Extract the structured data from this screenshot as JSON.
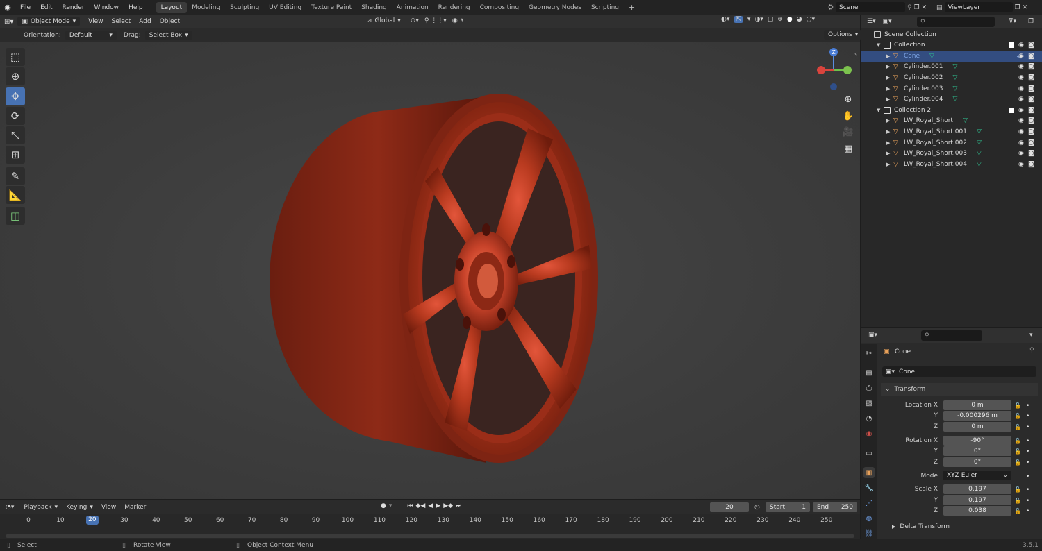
{
  "topbar": {
    "menus": [
      "File",
      "Edit",
      "Render",
      "Window",
      "Help"
    ],
    "workspaces": [
      "Layout",
      "Modeling",
      "Sculpting",
      "UV Editing",
      "Texture Paint",
      "Shading",
      "Animation",
      "Rendering",
      "Compositing",
      "Geometry Nodes",
      "Scripting"
    ],
    "active_workspace": "Layout",
    "add_tab": "+",
    "scene": "Scene",
    "view_layer": "ViewLayer"
  },
  "viewport_header": {
    "mode": "Object Mode",
    "menus": [
      "View",
      "Select",
      "Add",
      "Object"
    ],
    "transform_orientation": "Global",
    "orientation_label": "Orientation:",
    "orientation_value": "Default",
    "drag_label": "Drag:",
    "drag_value": "Select Box",
    "options": "Options"
  },
  "gizmo": {
    "z": "Z"
  },
  "outliner": {
    "root": "Scene Collection",
    "rows": [
      {
        "name": "Collection",
        "type": "collection",
        "indent": 1
      },
      {
        "name": "Cone",
        "type": "mesh",
        "indent": 2,
        "selected": true
      },
      {
        "name": "Cylinder.001",
        "type": "mesh",
        "indent": 2
      },
      {
        "name": "Cylinder.002",
        "type": "mesh",
        "indent": 2
      },
      {
        "name": "Cylinder.003",
        "type": "mesh",
        "indent": 2
      },
      {
        "name": "Cylinder.004",
        "type": "mesh",
        "indent": 2
      },
      {
        "name": "Collection 2",
        "type": "collection",
        "indent": 1
      },
      {
        "name": "LW_Royal_Short",
        "type": "mesh",
        "indent": 2
      },
      {
        "name": "LW_Royal_Short.001",
        "type": "mesh",
        "indent": 2
      },
      {
        "name": "LW_Royal_Short.002",
        "type": "mesh",
        "indent": 2
      },
      {
        "name": "LW_Royal_Short.003",
        "type": "mesh",
        "indent": 2
      },
      {
        "name": "LW_Royal_Short.004",
        "type": "mesh",
        "indent": 2
      }
    ]
  },
  "properties": {
    "object_name": "Cone",
    "object_field": "Cone",
    "transform_title": "Transform",
    "location_label": "Location X",
    "rotation_label": "Rotation X",
    "scale_label": "Scale X",
    "y_label": "Y",
    "z_label": "Z",
    "location": [
      "0 m",
      "-0.000296 m",
      "0 m"
    ],
    "rotation": [
      "-90°",
      "0°",
      "0°"
    ],
    "mode_label": "Mode",
    "mode_value": "XYZ Euler",
    "scale": [
      "0.197",
      "0.197",
      "0.038"
    ],
    "delta_transform": "Delta Transform"
  },
  "timeline": {
    "menus": [
      "Playback",
      "Keying",
      "View",
      "Marker"
    ],
    "current_frame": "20",
    "start_label": "Start",
    "start": "1",
    "end_label": "End",
    "end": "250",
    "ticks": [
      "0",
      "10",
      "20",
      "30",
      "40",
      "50",
      "60",
      "70",
      "80",
      "90",
      "100",
      "110",
      "120",
      "130",
      "140",
      "150",
      "160",
      "170",
      "180",
      "190",
      "200",
      "210",
      "220",
      "230",
      "240",
      "250"
    ]
  },
  "statusbar": {
    "select": "Select",
    "rotate": "Rotate View",
    "context": "Object Context Menu",
    "version": "3.5.1"
  },
  "colors": {
    "accent": "#4772b3",
    "wheel": "#b3361c",
    "mesh_icon": "#e8a15a",
    "data_icon": "#2fbf8f"
  }
}
